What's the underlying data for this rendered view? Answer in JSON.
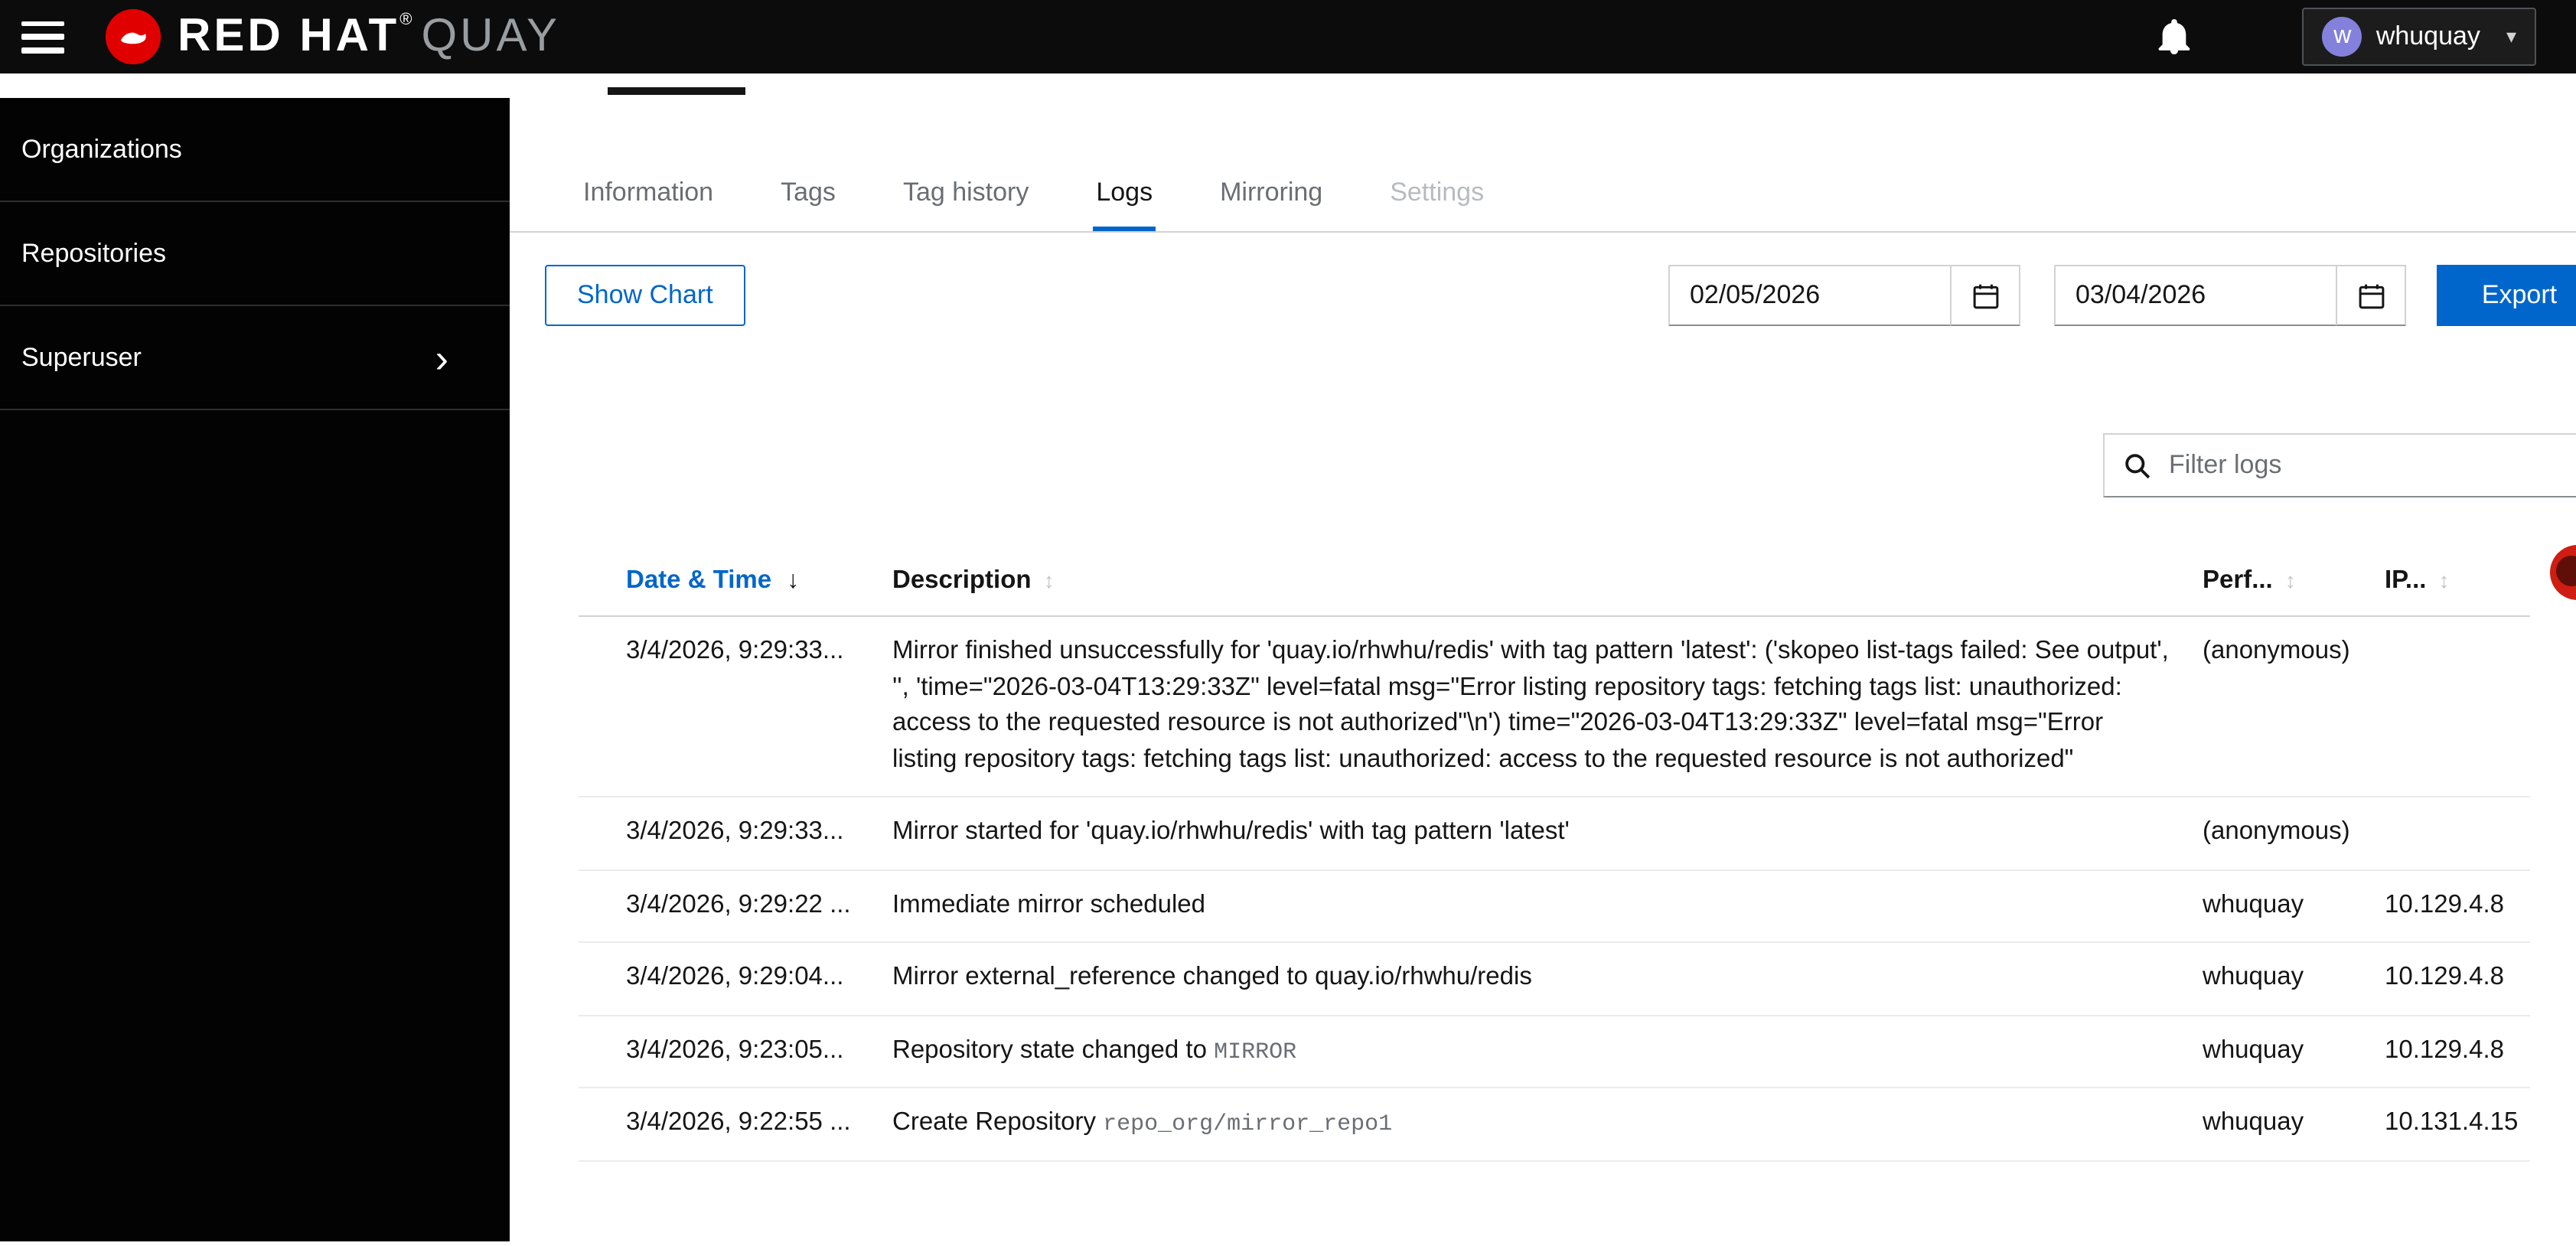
{
  "colors": {
    "accent_blue": "#0066cc",
    "header_bg": "#0c0c0c",
    "brand_red": "#ee0000",
    "avatar_purple": "#8481dd"
  },
  "header": {
    "brand_red_hat": "RED HAT",
    "brand_reg": "®",
    "brand_quay": "QUAY",
    "user": {
      "name": "whuquay",
      "initial": "w"
    }
  },
  "sidebar": {
    "items": [
      {
        "label": "Organizations"
      },
      {
        "label": "Repositories"
      },
      {
        "label": "Superuser"
      }
    ]
  },
  "tabs": [
    {
      "label": "Information"
    },
    {
      "label": "Tags"
    },
    {
      "label": "Tag history"
    },
    {
      "label": "Logs"
    },
    {
      "label": "Mirroring"
    },
    {
      "label": "Settings"
    }
  ],
  "toolbar": {
    "show_chart": "Show Chart",
    "date_from": "02/05/2026",
    "date_to": "03/04/2026",
    "export": "Export"
  },
  "filter": {
    "placeholder": "Filter logs"
  },
  "logs_table": {
    "columns": {
      "date": "Date & Time",
      "description": "Description",
      "performed_by": "Perf...",
      "ip": "IP..."
    },
    "rows": [
      {
        "date": "3/4/2026, 9:29:33...",
        "description": "Mirror finished unsuccessfully for 'quay.io/rhwhu/redis' with tag pattern 'latest': ('skopeo list-tags failed: See output', '', 'time=\"2026-03-04T13:29:33Z\" level=fatal msg=\"Error listing repository tags: fetching tags list: unauthorized: access to the requested resource is not authorized\"\\n') time=\"2026-03-04T13:29:33Z\" level=fatal msg=\"Error listing repository tags: fetching tags list: unauthorized: access to the requested resource is not authorized\"",
        "performed_by": "(anonymous)",
        "ip": ""
      },
      {
        "date": "3/4/2026, 9:29:33...",
        "description": "Mirror started for 'quay.io/rhwhu/redis' with tag pattern 'latest'",
        "performed_by": "(anonymous)",
        "ip": ""
      },
      {
        "date": "3/4/2026, 9:29:22 ...",
        "description": "Immediate mirror scheduled",
        "performed_by": "whuquay",
        "ip": "10.129.4.8"
      },
      {
        "date": "3/4/2026, 9:29:04...",
        "description": "Mirror external_reference changed to quay.io/rhwhu/redis",
        "performed_by": "whuquay",
        "ip": "10.129.4.8"
      },
      {
        "date": "3/4/2026, 9:23:05...",
        "description": "Repository state changed to ",
        "code": "MIRROR",
        "performed_by": "whuquay",
        "ip": "10.129.4.8"
      },
      {
        "date": "3/4/2026, 9:22:55 ...",
        "description": "Create Repository ",
        "code": "repo_org/mirror_repo1",
        "performed_by": "whuquay",
        "ip": "10.131.4.15"
      }
    ]
  }
}
